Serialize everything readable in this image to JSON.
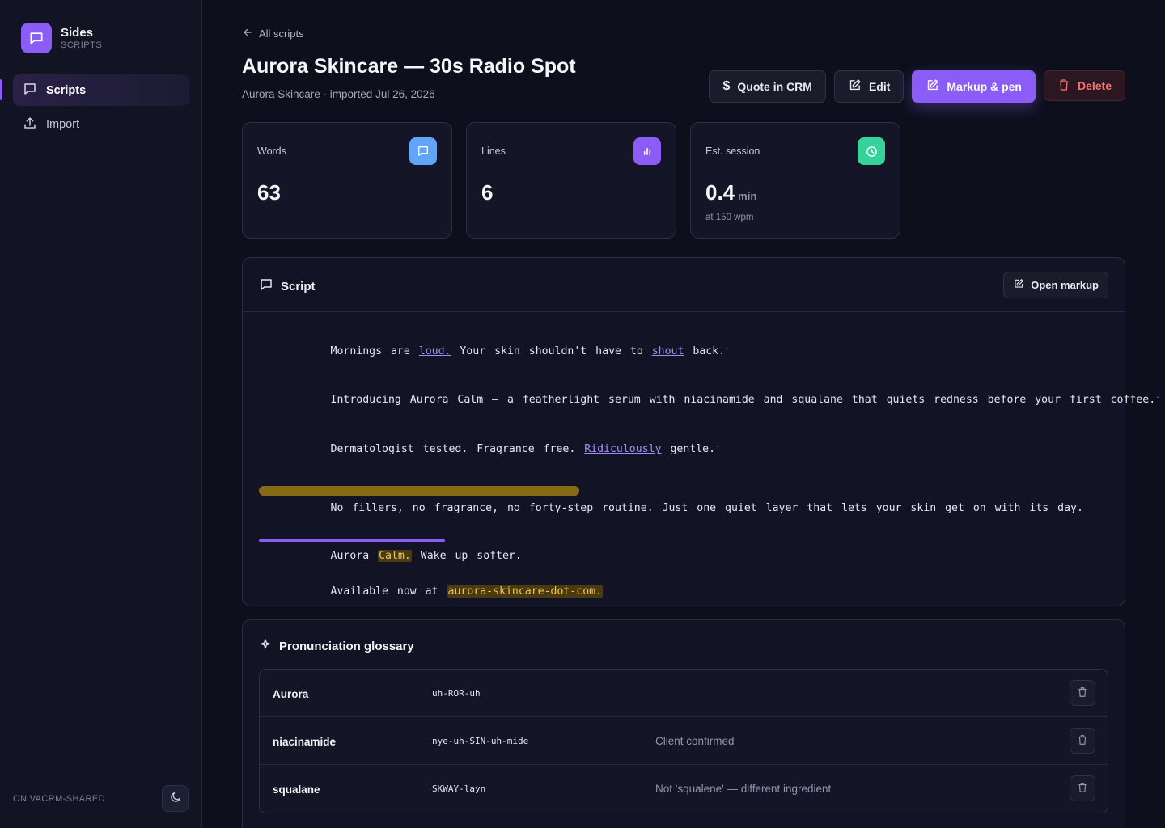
{
  "sidebar": {
    "brand_name": "Sides",
    "brand_sub": "SCRIPTS",
    "items": [
      {
        "label": "Scripts"
      },
      {
        "label": "Import"
      }
    ],
    "env_label": "ON VACRM-SHARED"
  },
  "header": {
    "back_label": "All scripts",
    "title": "Aurora Skincare — 30s Radio Spot",
    "meta": "Aurora Skincare · imported Jul 26, 2026",
    "actions": {
      "quote": "Quote in CRM",
      "edit": "Edit",
      "markup": "Markup & pen",
      "delete": "Delete"
    }
  },
  "stats": {
    "words": {
      "label": "Words",
      "value": "63"
    },
    "lines": {
      "label": "Lines",
      "value": "6"
    },
    "session": {
      "label": "Est. session",
      "value": "0.4",
      "unit": "min",
      "note": "at 150 wpm"
    }
  },
  "script": {
    "title": "Script",
    "open_markup": "Open markup",
    "line1": {
      "a": "Mornings are ",
      "b": "loud.",
      "c": " Your skin shouldn't have to ",
      "d": "shout",
      "e": " back."
    },
    "line2": "Introducing Aurora Calm — a featherlight serum with niacinamide and squalane that quiets redness before your first coffee.",
    "line3": {
      "a": "Dermatologist tested. Fragrance free. ",
      "b": "Ridiculously",
      "c": " gentle."
    },
    "line4": {
      "a": "No fillers, no fragrance, no forty-step routine.",
      "b": " Just one quiet layer that lets your skin get on with its day."
    },
    "line5": {
      "a": "Aurora ",
      "b": "Calm.",
      "c": " Wake up softer."
    },
    "line6": {
      "a": "Available now at ",
      "b": "aurora-skincare-dot-com."
    },
    "pause_mark": "ˇ"
  },
  "glossary": {
    "title": "Pronunciation glossary",
    "rows": [
      {
        "term": "Aurora",
        "pron": "uh-ROR-uh",
        "note": ""
      },
      {
        "term": "niacinamide",
        "pron": "nye-uh-SIN-uh-mide",
        "note": "Client confirmed"
      },
      {
        "term": "squalane",
        "pron": "SKWAY-layn",
        "note": "Not 'squalene' — different ingredient"
      }
    ]
  },
  "colors": {
    "accent": "#8b5cf6",
    "words_icon": "#60a5fa",
    "lines_icon": "#8b5cf6",
    "session_icon": "#34d399",
    "danger": "#f87171",
    "highlight": "#f5c451"
  }
}
